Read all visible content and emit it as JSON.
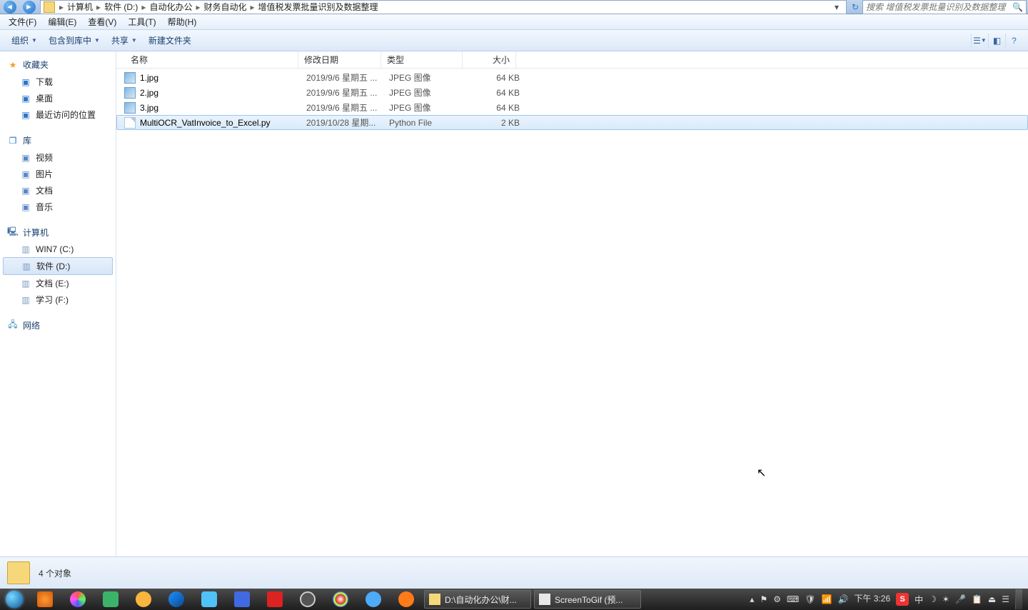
{
  "address": {
    "crumbs": [
      "计算机",
      "软件 (D:)",
      "自动化办公",
      "财务自动化",
      "增值税发票批量识别及数据整理"
    ]
  },
  "search": {
    "placeholder": "搜索 增值税发票批量识别及数据整理"
  },
  "menu": {
    "file": "文件(F)",
    "edit": "编辑(E)",
    "view": "查看(V)",
    "tools": "工具(T)",
    "help": "帮助(H)"
  },
  "toolbar": {
    "organize": "组织",
    "include": "包含到库中",
    "share": "共享",
    "newfolder": "新建文件夹"
  },
  "sidebar": {
    "fav_h": "收藏夹",
    "fav": [
      {
        "icon": "dl",
        "label": "下载"
      },
      {
        "icon": "desk",
        "label": "桌面"
      },
      {
        "icon": "clock",
        "label": "最近访问的位置"
      }
    ],
    "lib_h": "库",
    "lib": [
      {
        "icon": "vid",
        "label": "视频"
      },
      {
        "icon": "pic",
        "label": "图片"
      },
      {
        "icon": "doc",
        "label": "文档"
      },
      {
        "icon": "mus",
        "label": "音乐"
      }
    ],
    "pc_h": "计算机",
    "drives": [
      {
        "label": "WIN7 (C:)",
        "sel": false
      },
      {
        "label": "软件 (D:)",
        "sel": true
      },
      {
        "label": "文档 (E:)",
        "sel": false
      },
      {
        "label": "学习 (F:)",
        "sel": false
      }
    ],
    "net_h": "网络"
  },
  "columns": {
    "name": "名称",
    "date": "修改日期",
    "type": "类型",
    "size": "大小"
  },
  "files": [
    {
      "icon": "jpg",
      "name": "1.jpg",
      "date": "2019/9/6 星期五 ...",
      "type": "JPEG 图像",
      "size": "64 KB",
      "sel": false
    },
    {
      "icon": "jpg",
      "name": "2.jpg",
      "date": "2019/9/6 星期五 ...",
      "type": "JPEG 图像",
      "size": "64 KB",
      "sel": false
    },
    {
      "icon": "jpg",
      "name": "3.jpg",
      "date": "2019/9/6 星期五 ...",
      "type": "JPEG 图像",
      "size": "64 KB",
      "sel": false
    },
    {
      "icon": "py",
      "name": "MultiOCR_VatInvoice_to_Excel.py",
      "date": "2019/10/28 星期...",
      "type": "Python File",
      "size": "2 KB",
      "sel": true
    }
  ],
  "status": {
    "text": "4 个对象"
  },
  "taskbar": {
    "tasks": [
      {
        "label": "D:\\自动化办公\\财...",
        "cls": "folder"
      },
      {
        "label": "ScreenToGif (预...",
        "cls": "app"
      }
    ],
    "clock_top": "下午 3:26",
    "ime": "中"
  }
}
